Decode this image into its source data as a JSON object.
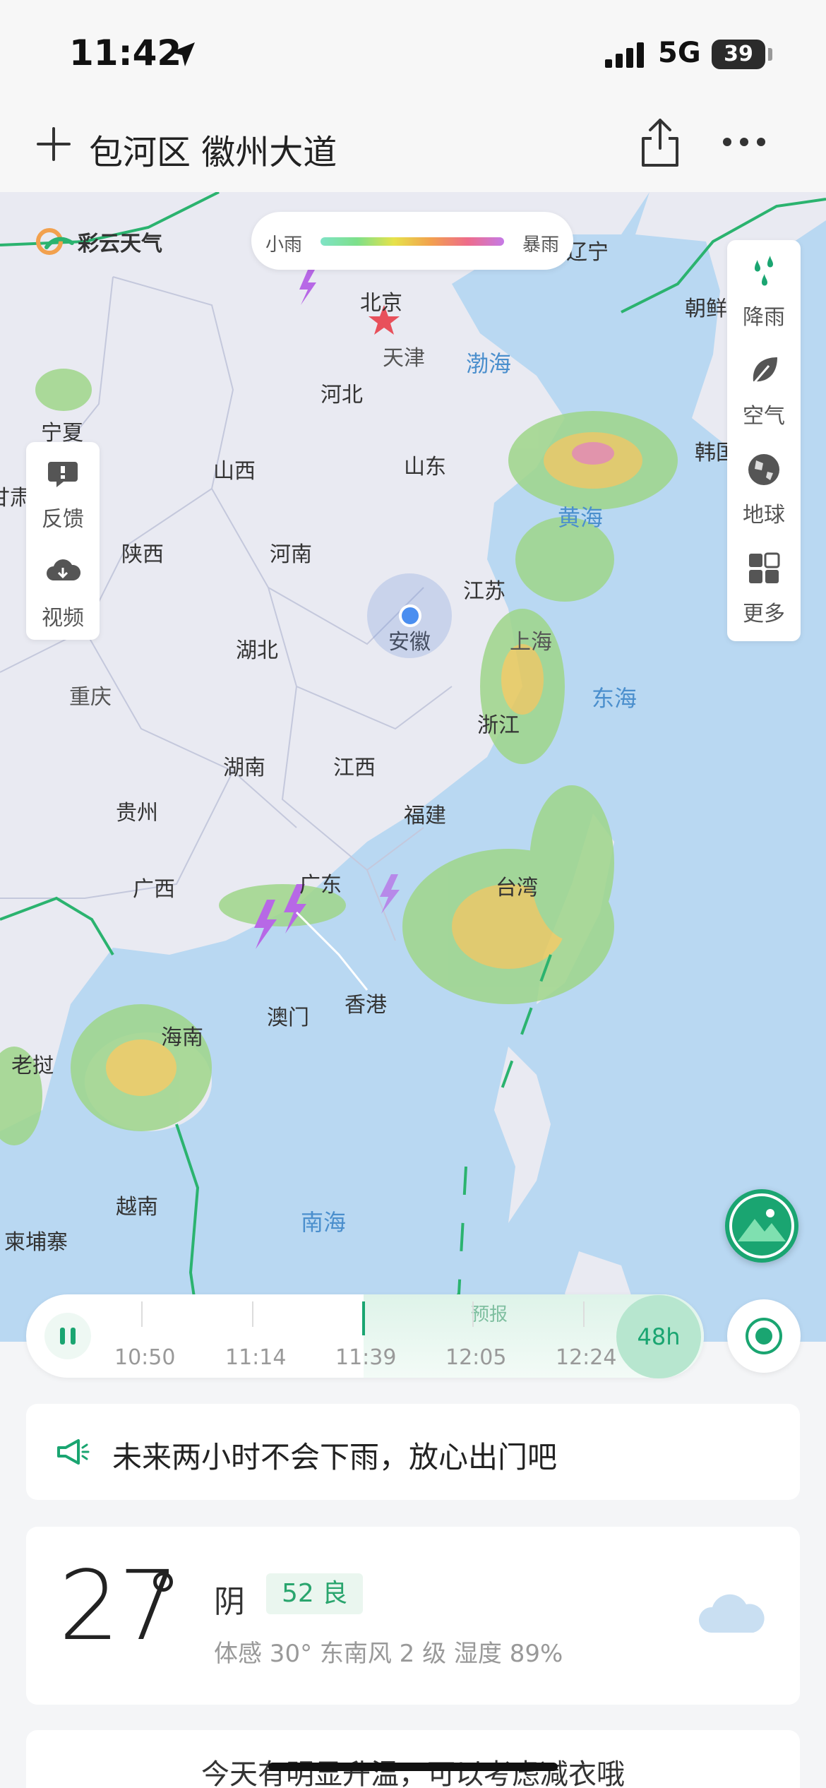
{
  "status_bar": {
    "time": "11:42",
    "network": "5G",
    "battery": "39"
  },
  "header": {
    "location": "包河区 徽州大道"
  },
  "map": {
    "brand": "彩云天气",
    "legend": {
      "min": "小雨",
      "max": "暴雨"
    },
    "left_tools": [
      {
        "label": "反馈",
        "icon": "feedback-icon"
      },
      {
        "label": "视频",
        "icon": "video-icon"
      }
    ],
    "right_tools": [
      {
        "label": "降雨",
        "icon": "rain-icon"
      },
      {
        "label": "空气",
        "icon": "leaf-icon"
      },
      {
        "label": "地球",
        "icon": "globe-icon"
      },
      {
        "label": "更多",
        "icon": "grid-icon"
      }
    ],
    "labels": {
      "beijing": "北京",
      "tianjin": "天津",
      "hebei": "河北",
      "shanxi": "山西",
      "shandong": "山东",
      "ningxia": "宁夏",
      "gansu": "甘肃",
      "shaanxi": "陕西",
      "henan": "河南",
      "jiangsu": "江苏",
      "anhui": "安徽",
      "hubei": "湖北",
      "shanghai": "上海",
      "chongqing": "重庆",
      "zhejiang": "浙江",
      "hunan": "湖南",
      "jiangxi": "江西",
      "guizhou": "贵州",
      "fujian": "福建",
      "guangxi": "广西",
      "guangdong": "广东",
      "taiwan": "台湾",
      "macau": "澳门",
      "hongkong": "香港",
      "hainan": "海南",
      "laos": "老挝",
      "vietnam": "越南",
      "cambodia": "柬埔寨",
      "liaoning": "辽宁",
      "korea_n": "朝鲜",
      "korea_s": "韩国",
      "bohai": "渤海",
      "yellow_sea": "黄海",
      "east_sea": "东海",
      "south_sea": "南海"
    }
  },
  "timeline": {
    "times": [
      "10:50",
      "11:14",
      "11:39",
      "12:05",
      "12:24"
    ],
    "forecast_label": "预报",
    "range_button": "48h"
  },
  "notice": {
    "text": "未来两小时不会下雨，放心出门吧"
  },
  "weather": {
    "temperature": "27",
    "condition": "阴",
    "aqi": "52 良",
    "details": "体感 30°  东南风 2 级  湿度 89%"
  },
  "tip": {
    "text": "今天有明显升温，可以考虑减衣哦"
  },
  "colors": {
    "accent": "#1aa571",
    "sea": "#b9d8f2",
    "land": "#e9eaf2"
  }
}
